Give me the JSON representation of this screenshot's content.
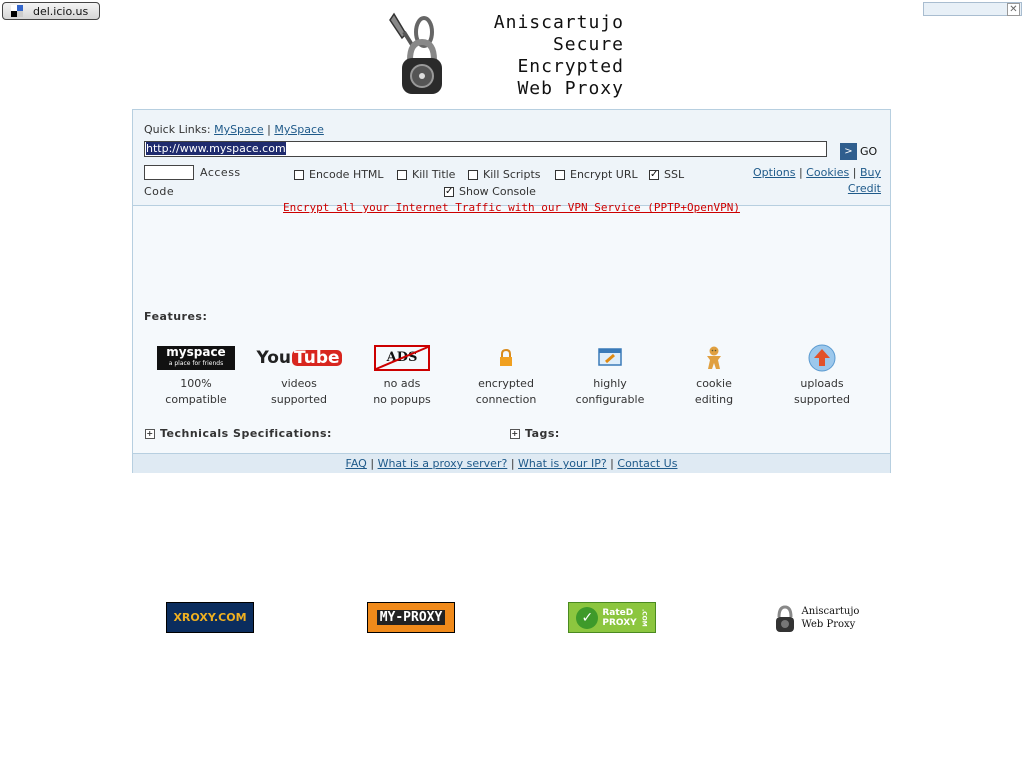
{
  "bookmark": {
    "label": "del.icio.us"
  },
  "header": {
    "lines": [
      "Aniscartujo",
      "Secure",
      "Encrypted",
      "Web Proxy"
    ]
  },
  "quick_links": {
    "prefix": "Quick Links:",
    "links": [
      "MySpace",
      "MySpace"
    ],
    "separator": "|"
  },
  "url_input": {
    "value": "http://www.myspace.com"
  },
  "go_button": {
    "label": "GO"
  },
  "access": {
    "label_part1": "Access",
    "label_part2": "Code"
  },
  "options_checkboxes": [
    {
      "label": "Encode HTML",
      "checked": false
    },
    {
      "label": "Kill Title",
      "checked": false
    },
    {
      "label": "Kill Scripts",
      "checked": false
    },
    {
      "label": "Encrypt URL",
      "checked": false
    },
    {
      "label": "SSL",
      "checked": true
    },
    {
      "label": "Show Console",
      "checked": true
    }
  ],
  "side_links": {
    "options": "Options",
    "cookies": "Cookies",
    "buy": "Buy",
    "credit": "Credit",
    "separator": "|"
  },
  "promo": {
    "text": "Encrypt all your Internet Traffic with our VPN Service (PPTP+OpenVPN)"
  },
  "features": {
    "label": "Features:",
    "items": [
      {
        "icon": "myspace-logo",
        "line1": "100%",
        "line2": "compatible"
      },
      {
        "icon": "youtube-logo",
        "line1": "videos",
        "line2": "supported"
      },
      {
        "icon": "no-ads-icon",
        "line1": "no ads",
        "line2": "no popups"
      },
      {
        "icon": "lock-icon",
        "line1": "encrypted",
        "line2": "connection"
      },
      {
        "icon": "configure-icon",
        "line1": "highly",
        "line2": "configurable"
      },
      {
        "icon": "gingerbread-cookie-icon",
        "line1": "cookie",
        "line2": "editing"
      },
      {
        "icon": "upload-icon",
        "line1": "uploads",
        "line2": "supported"
      }
    ]
  },
  "sections": {
    "tech": "Technicals Specifications:",
    "tags": "Tags:"
  },
  "footer_links": {
    "faq": "FAQ",
    "what_proxy": "What is a proxy server?",
    "what_ip": "What is your IP?",
    "contact": "Contact Us",
    "separator": "|"
  },
  "logos_text": {
    "myspace": "myspace",
    "myspace_tag": "a place for friends",
    "youtube_you": "You",
    "youtube_tube": "Tube",
    "ads": "ADS"
  },
  "partner_badges": {
    "xroxy": "XROXY.COM",
    "myproxy": "MY-PROXY",
    "rated_line1": "RateD",
    "rated_line2": "PROXY",
    "rated_com": ".COM",
    "anis_line1": "Aniscartujo",
    "anis_line2": "Web Proxy"
  },
  "colors": {
    "panel_bg": "#f5f9fc",
    "border": "#b7cfe0",
    "link": "#1f5a8a",
    "promo": "#cc0000"
  }
}
